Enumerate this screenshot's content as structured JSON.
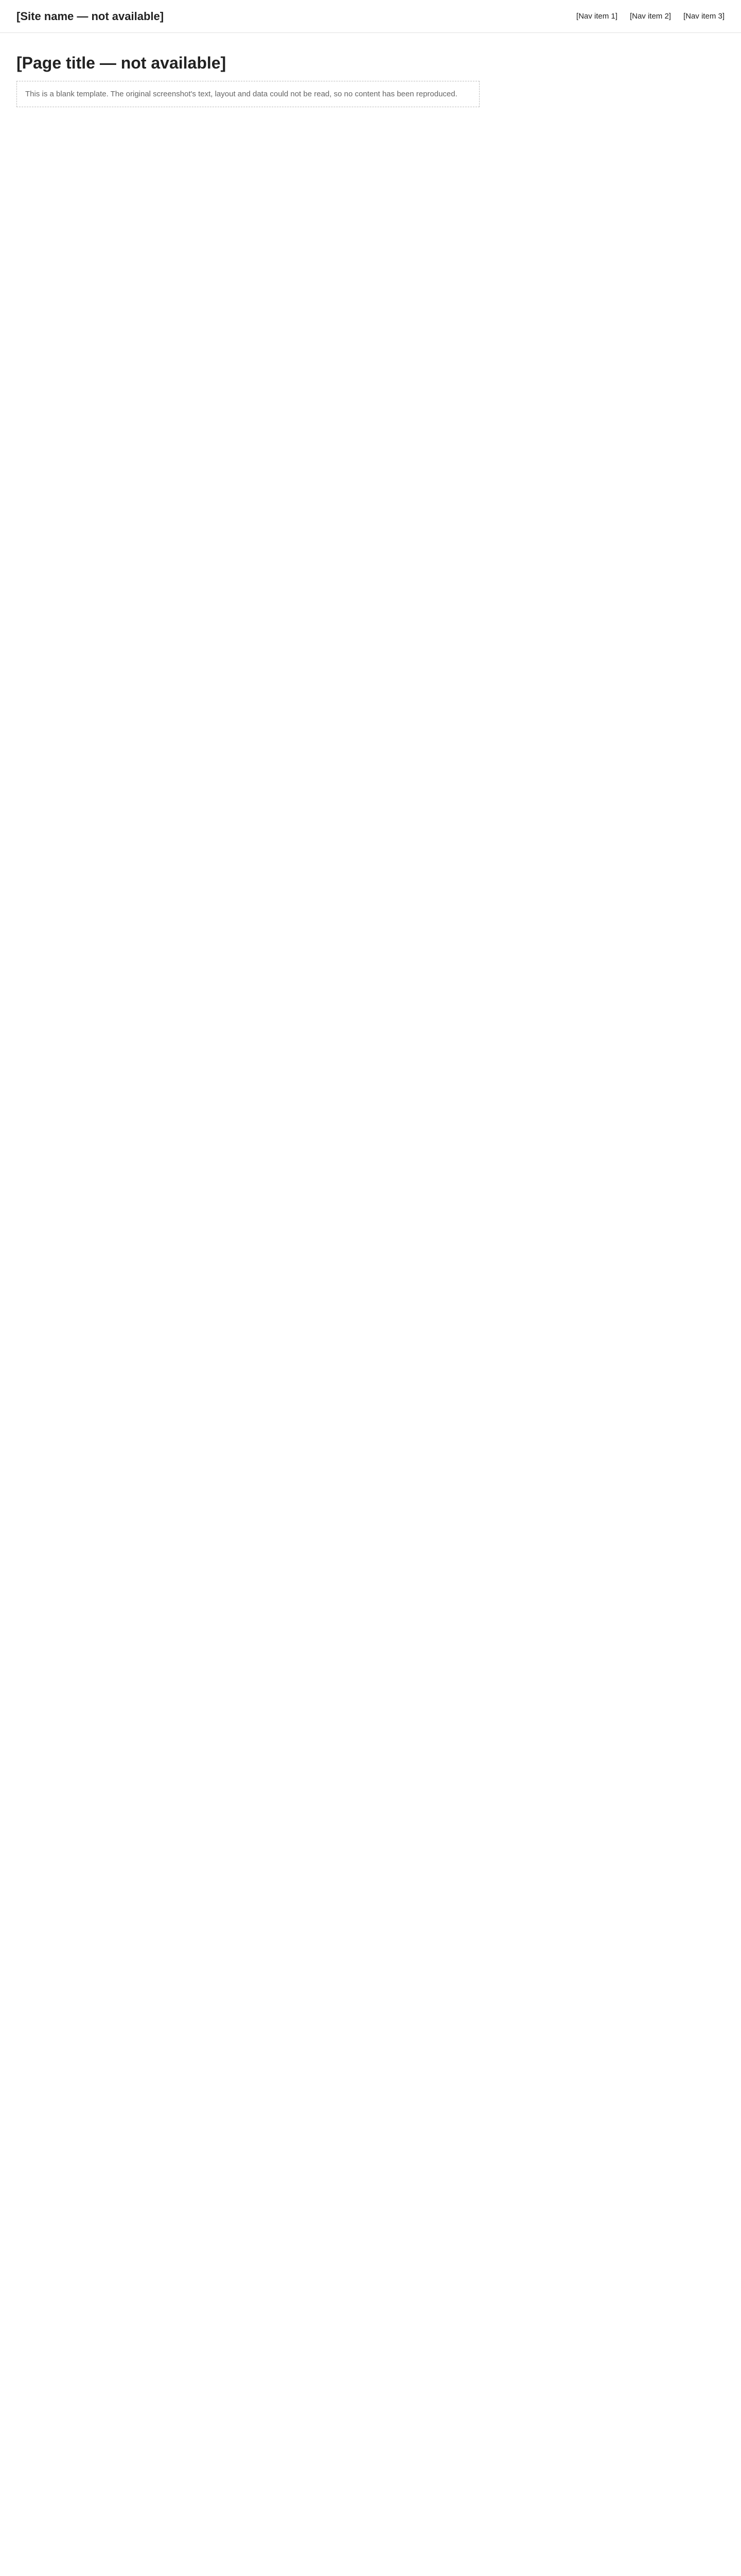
{
  "header": {
    "brand": "[Site name — not available]",
    "nav": [
      "[Nav item 1]",
      "[Nav item 2]",
      "[Nav item 3]"
    ]
  },
  "main": {
    "title": "[Page title — not available]",
    "note": "This is a blank template. The original screenshot's text, layout and data could not be read, so no content has been reproduced."
  }
}
